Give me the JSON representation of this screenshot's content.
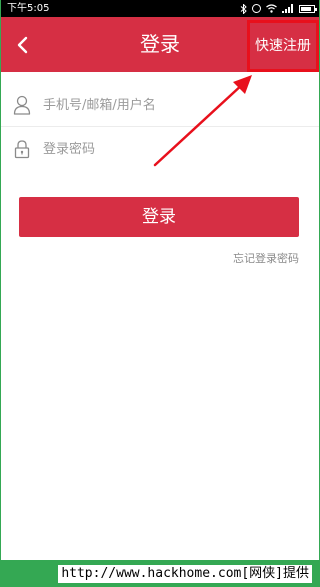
{
  "status_bar": {
    "time": "下午5:05",
    "icons": [
      "bluetooth-icon",
      "alarm-icon",
      "wifi-icon",
      "signal-icon",
      "battery-icon"
    ]
  },
  "header": {
    "title": "登录",
    "back_icon": "chevron-left-icon",
    "register_label": "快速注册",
    "background": "#d62f44"
  },
  "form": {
    "username": {
      "icon": "user-icon",
      "placeholder": "手机号/邮箱/用户名",
      "value": ""
    },
    "password": {
      "icon": "lock-icon",
      "placeholder": "登录密码",
      "value": ""
    }
  },
  "login_button_label": "登录",
  "forgot_password_label": "忘记登录密码",
  "watermark": "http://www.hackhome.com[网侠]提供",
  "colors": {
    "primary": "#d62f44",
    "highlight": "#e8101c",
    "frame": "#34a853"
  }
}
